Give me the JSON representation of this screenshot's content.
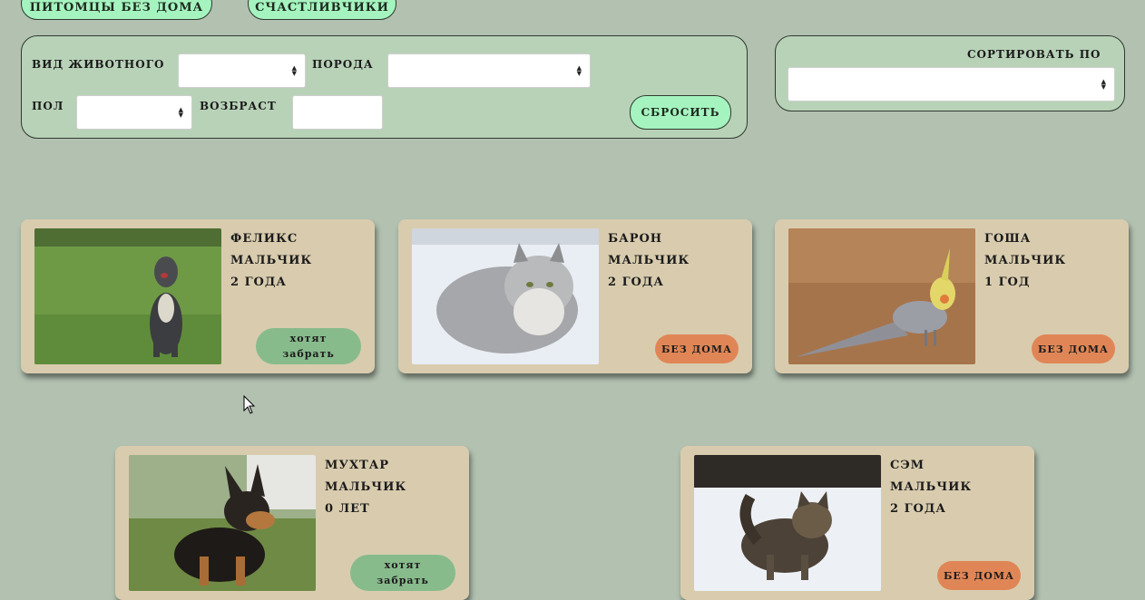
{
  "nav": {
    "homeless_tab": "питомцы без дома",
    "lucky_tab": "счастливчики"
  },
  "filters": {
    "animal_type_label": "вид животного",
    "breed_label": "порода",
    "gender_label": "пол",
    "age_label": "возбраст",
    "animal_type_value": "",
    "breed_value": "",
    "gender_value": "",
    "age_value": "",
    "reset_label": "сбросить"
  },
  "sort": {
    "label": "сортировать по",
    "value": ""
  },
  "pets": [
    {
      "name": "феликс",
      "gender": "мальчик",
      "age": "2 года",
      "status": "хотят забрать",
      "status_type": "wanted",
      "photo": "dog-pitbull"
    },
    {
      "name": "барон",
      "gender": "мальчик",
      "age": "2 года",
      "status": "без дома",
      "status_type": "homeless",
      "photo": "cat-fluffy-gray"
    },
    {
      "name": "гоша",
      "gender": "мальчик",
      "age": "1 год",
      "status": "без дома",
      "status_type": "homeless",
      "photo": "cockatiel-bird"
    },
    {
      "name": "мухтар",
      "gender": "мальчик",
      "age": "0 лет",
      "status": "хотят забрать",
      "status_type": "wanted",
      "photo": "shepherd-puppy"
    },
    {
      "name": "сэм",
      "gender": "мальчик",
      "age": "2 года",
      "status": "без дома",
      "status_type": "homeless",
      "photo": "cat-in-snow"
    }
  ],
  "colors": {
    "background": "#b2c1b0",
    "panel": "#b8d2b8",
    "card": "#d9ccae",
    "button_green": "#a5f4c0",
    "wanted_badge": "#88bb8c",
    "homeless_badge": "#e08656"
  }
}
